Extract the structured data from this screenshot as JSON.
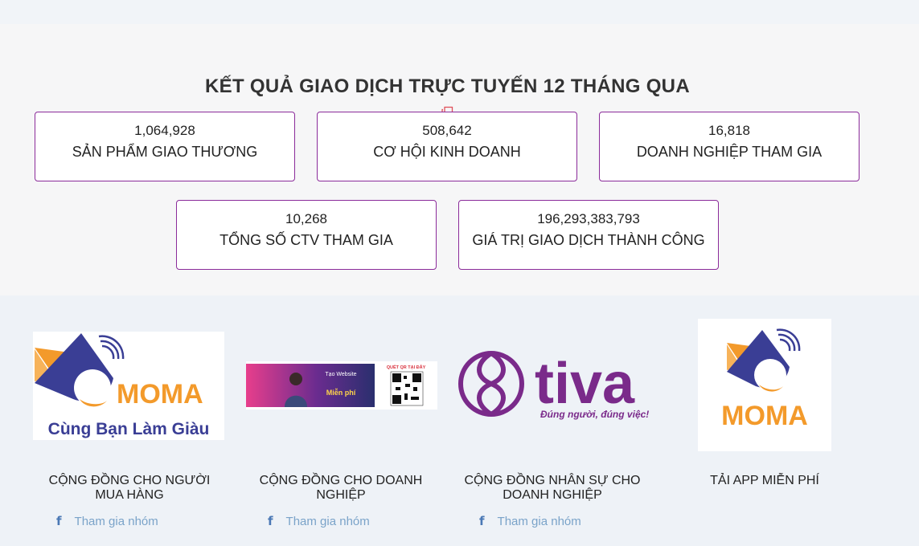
{
  "stats": {
    "title": "KẾT QUẢ GIAO DỊCH TRỰC TUYẾN 12 THÁNG QUA",
    "items": [
      {
        "value": "1,064,928",
        "label": "SẢN PHẨM GIAO THƯƠNG"
      },
      {
        "value": "508,642",
        "label": "CƠ HỘI KINH DOANH"
      },
      {
        "value": "16,818",
        "label": "DOANH NGHIỆP THAM GIA"
      },
      {
        "value": "10,268",
        "label": "TỔNG SỐ CTV THAM GIA"
      },
      {
        "value": "196,293,383,793",
        "label": "GIÁ TRỊ GIAO DỊCH THÀNH CÔNG"
      }
    ]
  },
  "communities": [
    {
      "title": "CỘNG ĐỒNG CHO NGƯỜI MUA HÀNG",
      "join": "Tham gia nhóm",
      "logo_text": "MOMA",
      "logo_slogan": "Cùng Bạn Làm Giàu"
    },
    {
      "title": "CỘNG ĐỒNG CHO DOANH NGHIỆP",
      "join": "Tham gia nhóm",
      "banner_qr": "QUÉT QR TẠI ĐÂY",
      "banner_head": "Tạo Website",
      "banner_free": "Miễn phí"
    },
    {
      "title": "CỘNG ĐỒNG NHÂN SỰ CHO DOANH NGHIỆP",
      "join": "Tham gia nhóm",
      "logo_text": "tiva",
      "logo_slogan": "Đúng người, đúng việc!"
    },
    {
      "title": "TẢI APP MIỄN PHÍ",
      "logo_text": "MOMA"
    }
  ],
  "colors": {
    "accent": "#8b2b9a",
    "orange": "#f39a2b",
    "navy": "#3a3e95",
    "tiva": "#7a2a8a"
  }
}
